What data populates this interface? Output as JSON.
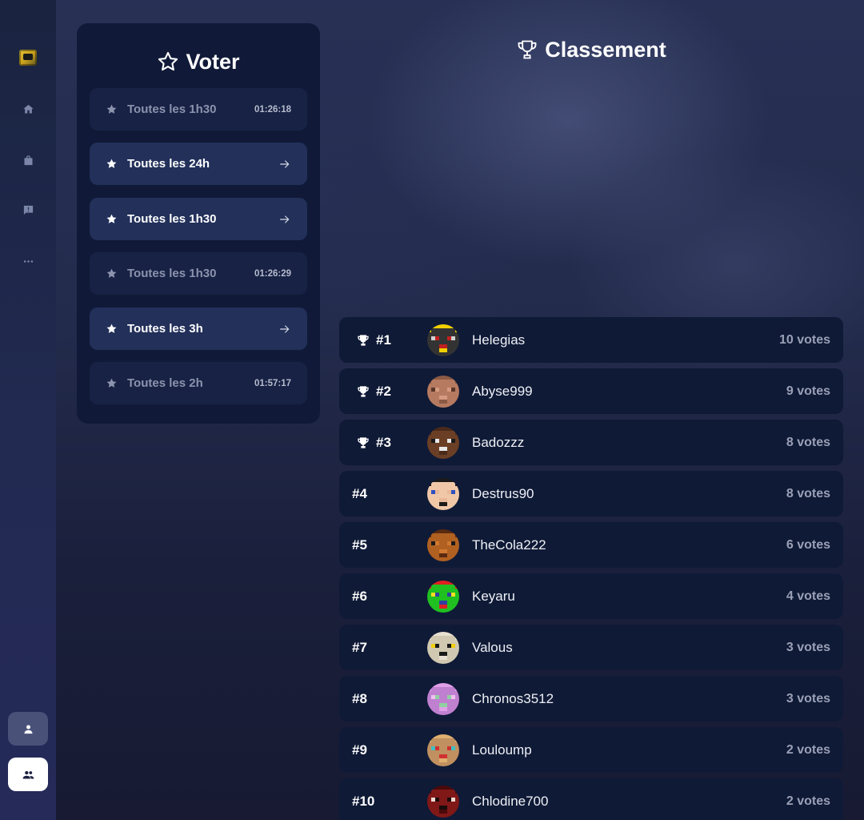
{
  "sidebar": {
    "logo": "server-logo",
    "nav": [
      {
        "name": "home",
        "icon": "home-icon"
      },
      {
        "name": "shop",
        "icon": "shopping-bag-icon"
      },
      {
        "name": "support",
        "icon": "chat-alert-icon"
      },
      {
        "name": "more",
        "icon": "more-icon"
      }
    ],
    "profile_icon": "user-icon",
    "group_icon": "users-icon"
  },
  "vote": {
    "title": "Voter",
    "items": [
      {
        "label": "Toutes les 1h30",
        "timer": "01:26:18",
        "state": "disabled"
      },
      {
        "label": "Toutes les 24h",
        "timer": "",
        "state": "active"
      },
      {
        "label": "Toutes les 1h30",
        "timer": "",
        "state": "active"
      },
      {
        "label": "Toutes les 1h30",
        "timer": "01:26:29",
        "state": "disabled"
      },
      {
        "label": "Toutes les 3h",
        "timer": "",
        "state": "active"
      },
      {
        "label": "Toutes les 2h",
        "timer": "01:57:17",
        "state": "disabled"
      }
    ]
  },
  "ranking": {
    "title": "Classement",
    "rows": [
      {
        "rank": "#1",
        "name": "Helegias",
        "votes": "10 votes",
        "trophy": true,
        "avatar": [
          "#f0d000",
          "#333",
          "#d0d0d0",
          "#c02020"
        ]
      },
      {
        "rank": "#2",
        "name": "Abyse999",
        "votes": "9 votes",
        "trophy": true,
        "avatar": [
          "#8b5a44",
          "#b57a60",
          "#5a3628",
          "#d69a80"
        ]
      },
      {
        "rank": "#3",
        "name": "Badozzz",
        "votes": "8 votes",
        "trophy": true,
        "avatar": [
          "#4a2a1a",
          "#6b3f25",
          "#1a1a1a",
          "#e8e8e8"
        ]
      },
      {
        "rank": "#4",
        "name": "Destrus90",
        "votes": "8 votes",
        "trophy": false,
        "avatar": [
          "#1a1a1a",
          "#f0c8a8",
          "#3050c0",
          "#e8b898"
        ]
      },
      {
        "rank": "#5",
        "name": "TheCola222",
        "votes": "6 votes",
        "trophy": false,
        "avatar": [
          "#5a2a10",
          "#b06020",
          "#1a1a1a",
          "#d07830"
        ]
      },
      {
        "rank": "#6",
        "name": "Keyaru",
        "votes": "4 votes",
        "trophy": false,
        "avatar": [
          "#e02020",
          "#20c020",
          "#f0e020",
          "#3040a0"
        ]
      },
      {
        "rank": "#7",
        "name": "Valous",
        "votes": "3 votes",
        "trophy": false,
        "avatar": [
          "#e8e0d0",
          "#d0c8b0",
          "#f0d010",
          "#1a1a1a"
        ]
      },
      {
        "rank": "#8",
        "name": "Chronos3512",
        "votes": "3 votes",
        "trophy": false,
        "avatar": [
          "#e0a0e8",
          "#c080d0",
          "#f0c0f0",
          "#90d0a0"
        ]
      },
      {
        "rank": "#9",
        "name": "Louloump",
        "votes": "2 votes",
        "trophy": false,
        "avatar": [
          "#e0b070",
          "#c09060",
          "#40c0c0",
          "#d03030"
        ]
      },
      {
        "rank": "#10",
        "name": "Chlodine700",
        "votes": "2 votes",
        "trophy": false,
        "avatar": [
          "#4a0a0a",
          "#801818",
          "#f0d8d0",
          "#1a0a0a"
        ]
      }
    ]
  },
  "colors": {
    "panel": "#101a38",
    "row": "#0f1a36",
    "vote_active": "#22305a",
    "vote_disabled": "#172245",
    "muted_text": "#9aa0b6"
  }
}
